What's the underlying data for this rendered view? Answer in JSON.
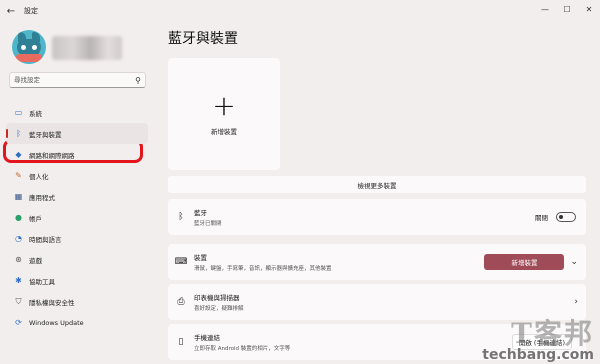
{
  "window": {
    "back_glyph": "←",
    "title": "設定",
    "controls": {
      "minimize": "—",
      "maximize": "☐",
      "close": "✕"
    }
  },
  "sidebar": {
    "search": {
      "placeholder": "尋找設定",
      "icon": "search-icon"
    },
    "items": [
      {
        "label": "系統",
        "icon": "monitor-icon",
        "glyph": "▭",
        "color": "#2d6fc7"
      },
      {
        "label": "藍牙與裝置",
        "icon": "bluetooth-icon",
        "glyph": "ᛒ",
        "color": "#2d6fc7",
        "active": true
      },
      {
        "label": "網路和網際網路",
        "icon": "wifi-icon",
        "glyph": "◆",
        "color": "#2d6fc7"
      },
      {
        "label": "個人化",
        "icon": "brush-icon",
        "glyph": "✎",
        "color": "#c86a2a"
      },
      {
        "label": "應用程式",
        "icon": "apps-icon",
        "glyph": "▦",
        "color": "#3a5a8a"
      },
      {
        "label": "帳戶",
        "icon": "person-icon",
        "glyph": "●",
        "color": "#2aa06a"
      },
      {
        "label": "時間與語言",
        "icon": "globe-clock-icon",
        "glyph": "◔",
        "color": "#2d6fc7"
      },
      {
        "label": "遊戲",
        "icon": "gamepad-icon",
        "glyph": "⊛",
        "color": "#555555"
      },
      {
        "label": "協助工具",
        "icon": "accessibility-icon",
        "glyph": "✱",
        "color": "#2d6fc7"
      },
      {
        "label": "隱私權與安全性",
        "icon": "shield-icon",
        "glyph": "⛉",
        "color": "#555555"
      },
      {
        "label": "Windows Update",
        "icon": "update-icon",
        "glyph": "⟳",
        "color": "#2d6fc7"
      }
    ]
  },
  "main": {
    "title": "藍牙與裝置",
    "add_device": {
      "plus": "+",
      "label": "新增裝置"
    },
    "view_more": "檢視更多裝置",
    "bluetooth": {
      "title": "藍牙",
      "subtitle": "藍牙已關閉",
      "toggle_label": "關閉",
      "on": false
    },
    "devices": {
      "title": "裝置",
      "subtitle": "滑鼠，鍵盤，手寫筆，音訊，顯示器與擴充座，其他裝置",
      "button": "新增裝置"
    },
    "printers": {
      "title": "印表機與掃描器",
      "subtitle": "喜好設定，疑難排解",
      "chevron": "›"
    },
    "phone": {
      "title": "手機連結",
      "subtitle": "立即存取 Android 裝置的相片，文字等",
      "dropdown": "開啟 (手機連結)"
    }
  },
  "watermark": {
    "top": "T客邦",
    "bottom": "techbang.com"
  }
}
